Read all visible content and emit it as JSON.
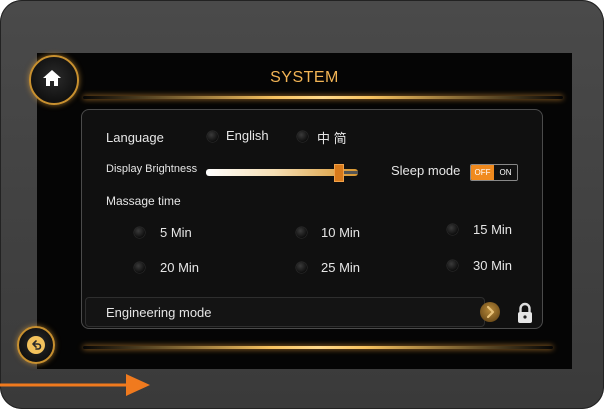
{
  "header": {
    "title": "SYSTEM"
  },
  "language": {
    "label": "Language",
    "options": [
      "English",
      "中 简"
    ]
  },
  "display": {
    "brightness_label": "Display Brightness",
    "brightness_level": 0.9
  },
  "sleep": {
    "label": "Sleep mode",
    "off_label": "OFF",
    "on_label": "ON",
    "state": "OFF"
  },
  "massage": {
    "label": "Massage time",
    "options": [
      "5 Min",
      "10 Min",
      "15 Min",
      "20 Min",
      "25 Min",
      "30 Min"
    ]
  },
  "engineering": {
    "label": "Engineering mode"
  },
  "icons": [
    "home-icon",
    "back-icon",
    "chevron-right-icon",
    "lock-icon",
    "arrow-right-icon"
  ],
  "colors": {
    "accent": "#f08a1e",
    "title": "#f2b455",
    "device": "#3f3f3f"
  }
}
